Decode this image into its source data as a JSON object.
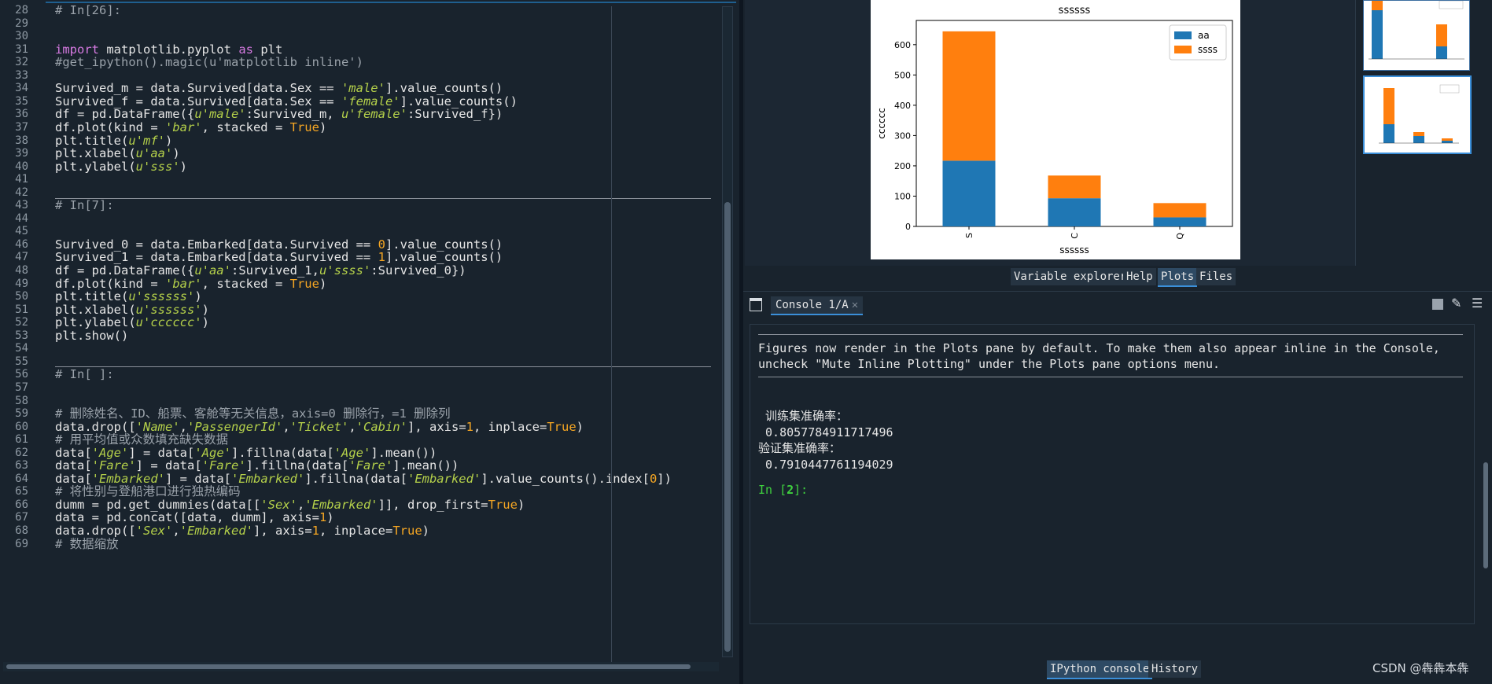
{
  "editor": {
    "lines": [
      {
        "n": "28",
        "html": "<span class=\"cmt\"># In[26]:</span>"
      },
      {
        "n": "29",
        "html": ""
      },
      {
        "n": "30",
        "html": ""
      },
      {
        "n": "31",
        "html": "<span class=\"kw\">import</span> matplotlib.pyplot <span class=\"kw\">as</span> plt"
      },
      {
        "n": "32",
        "html": "<span class=\"cmt\">#get_ipython().magic(u'matplotlib inline')</span>"
      },
      {
        "n": "33",
        "html": ""
      },
      {
        "n": "34",
        "html": "Survived_m = data.Survived[data.Sex == <span class=\"str\">'male'</span>].value_counts()"
      },
      {
        "n": "35",
        "html": "Survived_f = data.Survived[data.Sex == <span class=\"str\">'female'</span>].value_counts()"
      },
      {
        "n": "36",
        "html": "df = pd.DataFrame({<span class=\"str\">u'male'</span>:Survived_m, <span class=\"str\">u'female'</span>:Survived_f})"
      },
      {
        "n": "37",
        "html": "df.plot(kind = <span class=\"str\">'bar'</span>, stacked = <span class=\"bool\">True</span>)"
      },
      {
        "n": "38",
        "html": "plt.title(<span class=\"str\">u'mf'</span>)"
      },
      {
        "n": "39",
        "html": "plt.xlabel(<span class=\"str\">u'aa'</span>)"
      },
      {
        "n": "40",
        "html": "plt.ylabel(<span class=\"str\">u'sss'</span>)"
      },
      {
        "n": "41",
        "html": ""
      },
      {
        "n": "42",
        "html": ""
      },
      {
        "n": "43",
        "html": "<span class=\"cmt\"># In[7]:</span>"
      },
      {
        "n": "44",
        "html": ""
      },
      {
        "n": "45",
        "html": ""
      },
      {
        "n": "46",
        "html": "Survived_0 = data.Embarked[data.Survived == <span class=\"num\">0</span>].value_counts()"
      },
      {
        "n": "47",
        "html": "Survived_1 = data.Embarked[data.Survived == <span class=\"num\">1</span>].value_counts()"
      },
      {
        "n": "48",
        "html": "df = pd.DataFrame({<span class=\"str\">u'aa'</span>:Survived_1,<span class=\"str\">u'ssss'</span>:Survived_0})"
      },
      {
        "n": "49",
        "html": "df.plot(kind = <span class=\"str\">'bar'</span>, stacked = <span class=\"bool\">True</span>)"
      },
      {
        "n": "50",
        "html": "plt.title(<span class=\"str\">u'ssssss'</span>)"
      },
      {
        "n": "51",
        "html": "plt.xlabel(<span class=\"str\">u'ssssss'</span>)"
      },
      {
        "n": "52",
        "html": "plt.ylabel(<span class=\"str\">u'cccccc'</span>)"
      },
      {
        "n": "53",
        "html": "plt.show()"
      },
      {
        "n": "54",
        "html": ""
      },
      {
        "n": "55",
        "html": ""
      },
      {
        "n": "56",
        "html": "<span class=\"cmt\"># In[ ]:</span>"
      },
      {
        "n": "57",
        "html": ""
      },
      {
        "n": "58",
        "html": ""
      },
      {
        "n": "59",
        "html": "<span class=\"cmt\"># 删除姓名、ID、船票、客舱等无关信息，axis=0 删除行，=1 删除列</span>"
      },
      {
        "n": "60",
        "html": "data.drop([<span class=\"str\">'Name'</span>,<span class=\"str\">'PassengerId'</span>,<span class=\"str\">'Ticket'</span>,<span class=\"str\">'Cabin'</span>], axis=<span class=\"num\">1</span>, inplace=<span class=\"bool\">True</span>)"
      },
      {
        "n": "61",
        "html": "<span class=\"cmt\"># 用平均值或众数填充缺失数据</span>"
      },
      {
        "n": "62",
        "html": "data[<span class=\"str\">'Age'</span>] = data[<span class=\"str\">'Age'</span>].fillna(data[<span class=\"str\">'Age'</span>].mean())"
      },
      {
        "n": "63",
        "html": "data[<span class=\"str\">'Fare'</span>] = data[<span class=\"str\">'Fare'</span>].fillna(data[<span class=\"str\">'Fare'</span>].mean())"
      },
      {
        "n": "64",
        "html": "data[<span class=\"str\">'Embarked'</span>] = data[<span class=\"str\">'Embarked'</span>].fillna(data[<span class=\"str\">'Embarked'</span>].value_counts().index[<span class=\"num\">0</span>])"
      },
      {
        "n": "65",
        "html": "<span class=\"cmt\"># 将性别与登船港口进行独热编码</span>"
      },
      {
        "n": "66",
        "html": "dumm = pd.get_dummies(data[[<span class=\"str\">'Sex'</span>,<span class=\"str\">'Embarked'</span>]], drop_first=<span class=\"bool\">True</span>)"
      },
      {
        "n": "67",
        "html": "data = pd.concat([data, dumm], axis=<span class=\"num\">1</span>)"
      },
      {
        "n": "68",
        "html": "data.drop([<span class=\"str\">'Sex'</span>,<span class=\"str\">'Embarked'</span>], axis=<span class=\"num\">1</span>, inplace=<span class=\"bool\">True</span>)"
      },
      {
        "n": "69",
        "html": "<span class=\"cmt\"># 数据缩放</span>"
      }
    ]
  },
  "plots_pane": {
    "tabs": [
      "Variable explorer",
      "Help",
      "Plots",
      "Files"
    ],
    "active_tab": "Plots"
  },
  "chart_data": {
    "type": "bar",
    "stacked": true,
    "title": "ssssss",
    "xlabel": "ssssss",
    "ylabel": "cccccc",
    "categories": [
      "S",
      "C",
      "Q"
    ],
    "series": [
      {
        "name": "aa",
        "values": [
          217,
          93,
          30
        ],
        "color": "#1f77b4"
      },
      {
        "name": "ssss",
        "values": [
          427,
          75,
          47
        ],
        "color": "#ff7f0e"
      }
    ],
    "ylim": [
      0,
      680
    ],
    "yticks": [
      0,
      100,
      200,
      300,
      400,
      500,
      600
    ],
    "legend": "top-right"
  },
  "console": {
    "tab_label": "Console 1/A",
    "message_line1": "Figures now render in the Plots pane by default. To make them also appear inline in the Console,",
    "message_line2": "uncheck \"Mute Inline Plotting\" under the Plots pane options menu.",
    "train_label": " 训练集准确率：",
    "train_value": " 0.8057784911717496",
    "val_label": "验证集准确率：",
    "val_value": " 0.7910447761194029",
    "prompt_in": "In [",
    "prompt_num": "2",
    "prompt_end": "]:",
    "bottom_tabs": [
      "IPython console",
      "History"
    ],
    "active_bottom_tab": "IPython console"
  },
  "watermark": "CSDN @犇犇本犇"
}
